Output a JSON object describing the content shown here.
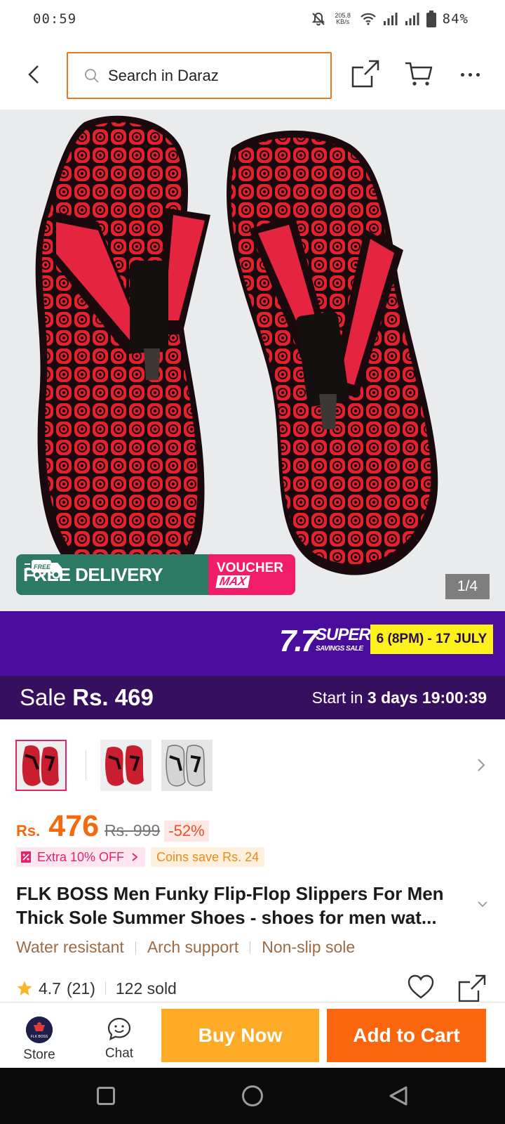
{
  "status_bar": {
    "time": "00:59",
    "net_speed_value": "205.8",
    "net_speed_unit": "KB/s",
    "battery": "84%"
  },
  "header": {
    "search_placeholder": "Search in Daraz"
  },
  "hero": {
    "free_delivery": "FREE DELIVERY",
    "free_tag": "FREE",
    "voucher_line1": "VOUCHER",
    "voucher_line2": "MAX",
    "page_indicator": "1/4"
  },
  "campaign": {
    "logo_number": "7.7",
    "logo_super": "SUPER",
    "logo_sub": "SAVINGS SALE",
    "dates": "6 (8PM) - 17 JULY",
    "background": "#4a0c9a",
    "date_badge_color": "#fdf11c"
  },
  "sale_strip": {
    "label": "Sale",
    "price": "Rs. 469",
    "start_prefix": "Start in",
    "start_days": "3 days",
    "countdown": "19:00:39"
  },
  "thumbnails": {
    "count": 3,
    "active_index": 0
  },
  "price": {
    "currency": "Rs.",
    "amount": "476",
    "original": "Rs. 999",
    "discount": "-52%",
    "accent": "#f5680b"
  },
  "promos": {
    "extra_off": "Extra 10% OFF",
    "coins": "Coins save Rs. 24"
  },
  "product": {
    "title": "FLK BOSS Men Funky Flip-Flop Slippers For Men Thick Sole Summer Shoes - shoes for men wat...",
    "features": [
      "Water resistant",
      "Arch support",
      "Non-slip sole"
    ],
    "rating": "4.7",
    "reviews": "(21)",
    "sold": "122 sold"
  },
  "action_bar": {
    "store_label": "Store",
    "store_logo_text": "FLK BOSS",
    "chat_label": "Chat",
    "buy_now": "Buy Now",
    "add_to_cart": "Add to Cart",
    "buy_color": "#fdaa26",
    "cart_color": "#f9660d"
  }
}
